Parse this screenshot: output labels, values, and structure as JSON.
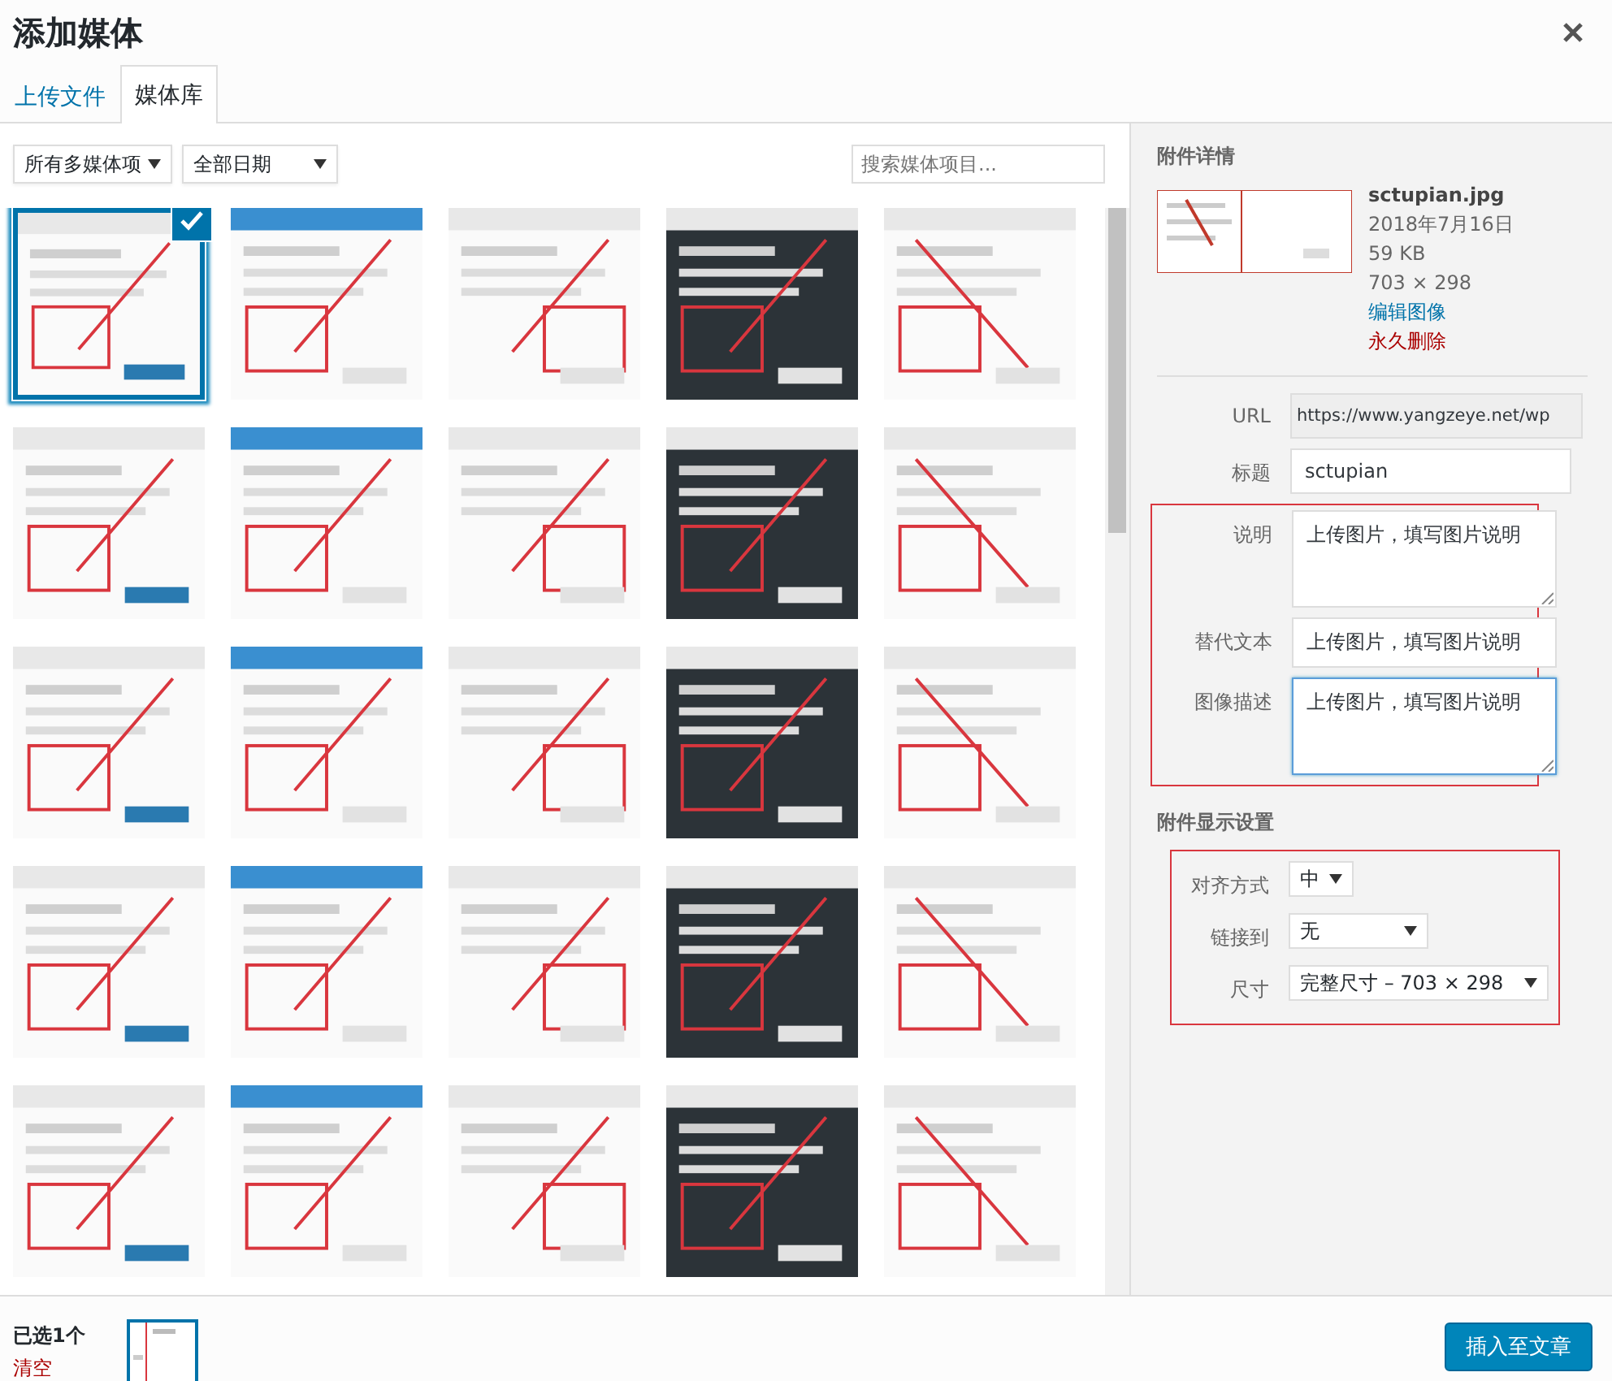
{
  "window": {
    "title": "添加媒体"
  },
  "tabs": [
    {
      "label": "上传文件",
      "selected": false
    },
    {
      "label": "媒体库",
      "selected": true
    }
  ],
  "filters": {
    "type": "所有多媒体项",
    "date": "全部日期",
    "search": {
      "placeholder": "搜索媒体项目..."
    }
  },
  "thumbnails": [
    {
      "kind": "picture",
      "selected": true
    },
    {
      "kind": "picture",
      "selected": false
    },
    {
      "kind": "picture",
      "selected": false
    },
    {
      "kind": "picture",
      "selected": false
    },
    {
      "kind": "picture",
      "selected": false
    },
    {
      "kind": "picture",
      "selected": false
    },
    {
      "kind": "picture",
      "selected": false
    },
    {
      "kind": "picture",
      "selected": false
    },
    {
      "kind": "picture",
      "selected": false
    },
    {
      "kind": "picture",
      "selected": false
    },
    {
      "kind": "picture",
      "selected": false
    },
    {
      "kind": "picture",
      "selected": false
    },
    {
      "kind": "picture",
      "selected": false
    },
    {
      "kind": "picture",
      "selected": false
    },
    {
      "kind": "picture",
      "selected": false
    },
    {
      "kind": "picture",
      "selected": false
    },
    {
      "kind": "picture",
      "selected": false
    },
    {
      "kind": "picture",
      "selected": false
    },
    {
      "kind": "picture",
      "selected": false
    },
    {
      "kind": "picture",
      "selected": false
    },
    {
      "kind": "picture",
      "selected": false
    },
    {
      "kind": "picture",
      "selected": false
    },
    {
      "kind": "picture",
      "selected": false
    },
    {
      "kind": "picture",
      "selected": false
    },
    {
      "kind": "picture",
      "selected": false
    }
  ],
  "details": {
    "heading": "附件详情",
    "filename": "sctupian.jpg",
    "date": "2018年7月16日",
    "size": "59 KB",
    "dimensions": "703 × 298",
    "edit_link": "编辑图像",
    "delete_link": "永久删除",
    "fields": [
      {
        "label": "URL",
        "value": "https://www.yangzeye.net/wp",
        "kind": "readonly"
      },
      {
        "label": "标题",
        "value": "sctupian",
        "kind": "input"
      },
      {
        "label": "说明",
        "value": "上传图片，填写图片说明",
        "kind": "textarea"
      },
      {
        "label": "替代文本",
        "value": "上传图片，填写图片说明",
        "kind": "input"
      },
      {
        "label": "图像描述",
        "value": "上传图片，填写图片说明",
        "kind": "textarea_focused"
      }
    ]
  },
  "display_settings": {
    "heading": "附件显示设置",
    "settings": [
      {
        "label": "对齐方式",
        "value": "中"
      },
      {
        "label": "链接到",
        "value": "无"
      },
      {
        "label": "尺寸",
        "value": "完整尺寸 – 703 × 298"
      }
    ]
  },
  "footer": {
    "selected_count": "已选1个",
    "clear_link": "清空",
    "insert_button": "插入至文章"
  }
}
